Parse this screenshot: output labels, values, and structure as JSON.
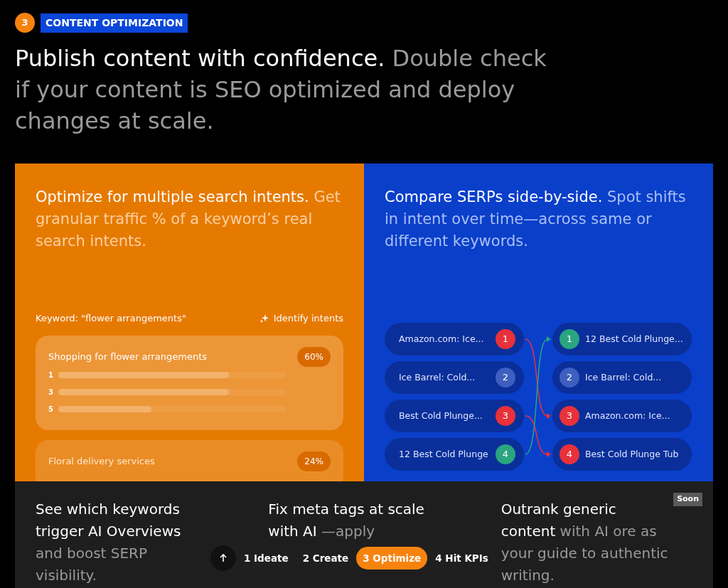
{
  "section": {
    "number": "3",
    "label": "CONTENT OPTIMIZATION"
  },
  "headline": {
    "strong": "Publish content with confidence.",
    "rest": "Double check if your content is SEO optimized and deploy changes at scale."
  },
  "intents_card": {
    "title": "Optimize for multiple search intents.",
    "subtitle": "Get granular traffic % of a keyword’s real search intents.",
    "keyword": "Keyword: \"flower arrangements\"",
    "action": "Identify intents",
    "intents": [
      {
        "name": "Shopping for flower arrangements",
        "share": "60%",
        "faded": false,
        "bars": [
          {
            "rank": "1",
            "level": 0.75
          },
          {
            "rank": "3",
            "level": 0.75
          },
          {
            "rank": "5",
            "level": 0.41
          }
        ]
      },
      {
        "name": "Floral delivery services",
        "share": "24%",
        "faded": true
      }
    ]
  },
  "serp_card": {
    "title": "Compare SERPs side-by-side.",
    "subtitle": "Spot shifts in intent over time—across same or different keywords.",
    "left": [
      {
        "title": "Amazon.com: Ice...",
        "rank": "1",
        "color": "#e8313a"
      },
      {
        "title": "Ice Barrel: Cold...",
        "rank": "2",
        "color": "#3d5fbf"
      },
      {
        "title": "Best Cold Plunge...",
        "rank": "3",
        "color": "#e8313a"
      },
      {
        "title": "12 Best Cold Plunge",
        "rank": "4",
        "color": "#2aa57f"
      }
    ],
    "right": [
      {
        "title": "12 Best Cold Plunge...",
        "rank": "1",
        "color": "#2aa57f"
      },
      {
        "title": "Ice Barrel: Cold...",
        "rank": "2",
        "color": "#3d5fbf"
      },
      {
        "title": "Amazon.com: Ice...",
        "rank": "3",
        "color": "#e8313a"
      },
      {
        "title": "Best Cold Plunge Tub",
        "rank": "4",
        "color": "#e8313a"
      }
    ]
  },
  "feature_cards": [
    {
      "strong": "See which keywords trigger AI Overviews",
      "rest": "and boost SERP visibility."
    },
    {
      "strong": "Fix meta tags at scale with AI",
      "rest": "—apply"
    },
    {
      "strong": "Outrank generic content",
      "rest": "with AI ore as your guide to authentic writing.",
      "badge": "Soon"
    }
  ],
  "step_nav": {
    "steps": [
      {
        "label": "1 Ideate",
        "selected": false
      },
      {
        "label": "2 Create",
        "selected": false
      },
      {
        "label": "3 Optimize",
        "selected": true
      },
      {
        "label": "4 Hit KPIs",
        "selected": false
      }
    ]
  }
}
